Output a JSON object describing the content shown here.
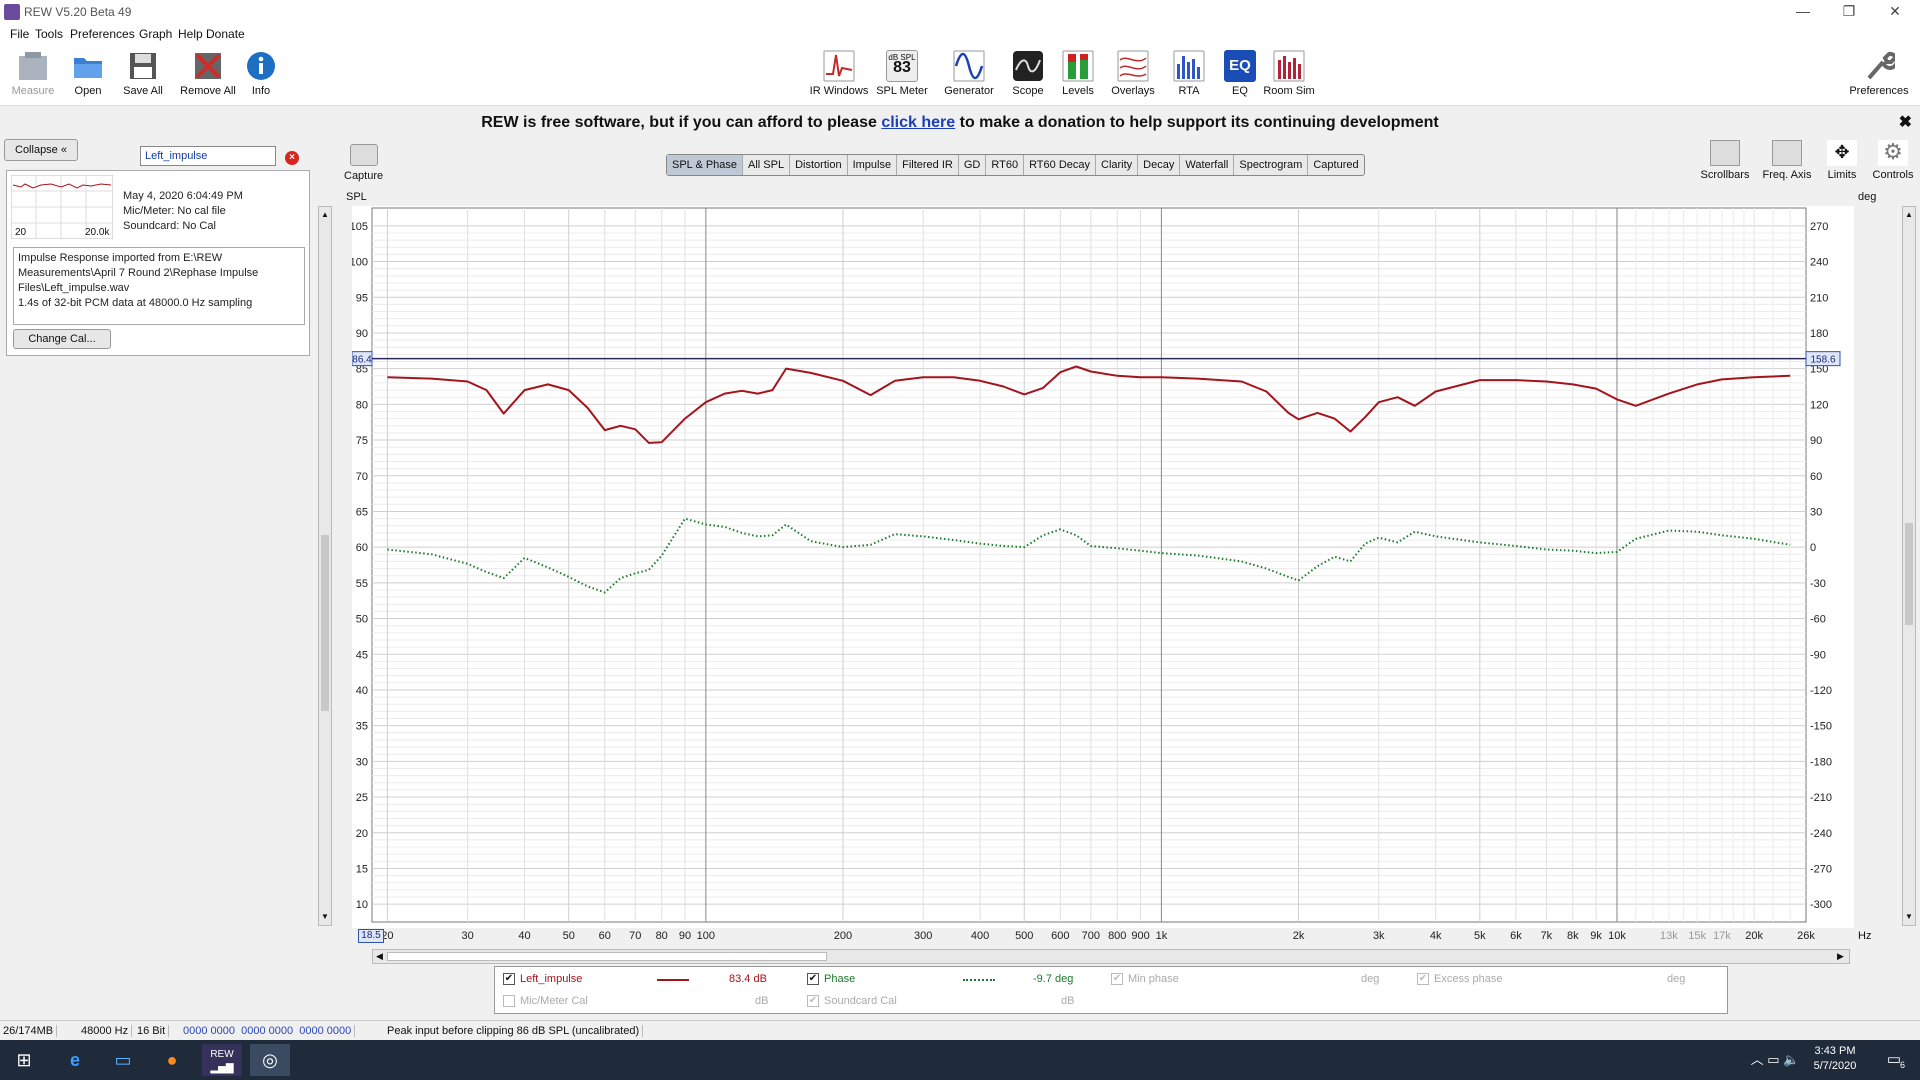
{
  "window": {
    "title": "REW V5.20 Beta 49",
    "min": "—",
    "max": "❐",
    "close": "✕"
  },
  "menu": [
    "File",
    "Tools",
    "Preferences",
    "Graph",
    "Help",
    "Donate"
  ],
  "toolbar_left": [
    {
      "label": "Measure",
      "icon": "microphone-icon",
      "color": "#9aa3ad"
    },
    {
      "label": "Open",
      "icon": "folder-icon",
      "color": "#3b7fd0"
    },
    {
      "label": "Save All",
      "icon": "floppy-icon",
      "color": "#555"
    },
    {
      "label": "Remove All",
      "icon": "remove-all-icon",
      "color": "#c0302a"
    },
    {
      "label": "Info",
      "icon": "info-icon",
      "color": "#1d6fc4"
    }
  ],
  "toolbar_center": [
    {
      "label": "IR Windows",
      "icon": "ir-windows-icon"
    },
    {
      "label": "SPL Meter",
      "icon": "spl-meter-icon",
      "value": "83",
      "unit": "dB SPL"
    },
    {
      "label": "Generator",
      "icon": "generator-icon"
    },
    {
      "label": "Scope",
      "icon": "scope-icon"
    },
    {
      "label": "Levels",
      "icon": "levels-icon"
    },
    {
      "label": "Overlays",
      "icon": "overlays-icon"
    },
    {
      "label": "RTA",
      "icon": "rta-icon"
    },
    {
      "label": "EQ",
      "icon": "eq-icon"
    },
    {
      "label": "Room Sim",
      "icon": "room-sim-icon"
    }
  ],
  "preferences_label": "Preferences",
  "donate": {
    "before": "REW is free software, but if you can afford to please",
    "link": "click here",
    "after": "to make a donation to help support its continuing development",
    "close": "✖"
  },
  "panel": {
    "collapse": "Collapse",
    "name": "Left_impulse",
    "date": "May 4, 2020 6:04:49 PM",
    "mic": "Mic/Meter: No cal file",
    "soundcard": "Soundcard: No Cal",
    "thumb_min": "20",
    "thumb_max": "20.0k",
    "notes": "Impulse Response imported from E:\\REW Measurements\\April 7 Round 2\\Rephase Impulse Files\\Left_impulse.wav\n1.4s of 32-bit PCM data at 48000.0 Hz sampling",
    "change_cal": "Change Cal..."
  },
  "capture": "Capture",
  "tabs": [
    "SPL & Phase",
    "All SPL",
    "Distortion",
    "Impulse",
    "Filtered IR",
    "GD",
    "RT60",
    "RT60 Decay",
    "Clarity",
    "Decay",
    "Waterfall",
    "Spectrogram",
    "Captured"
  ],
  "selected_tab": "SPL & Phase",
  "right_buttons": [
    "Scrollbars",
    "Freq. Axis",
    "Limits",
    "Controls"
  ],
  "axis": {
    "left_unit": "SPL",
    "right_unit": "deg",
    "x_unit": "Hz",
    "left_ticks": [
      "105",
      "100",
      "95",
      "90",
      "85",
      "80",
      "75",
      "70",
      "65",
      "60",
      "55",
      "50",
      "45",
      "40",
      "35",
      "30",
      "25",
      "20",
      "15",
      "10"
    ],
    "right_ticks": [
      "270",
      "240",
      "210",
      "180",
      "150",
      "120",
      "90",
      "60",
      "30",
      "0",
      "-30",
      "-60",
      "-90",
      "-120",
      "-150",
      "-180",
      "-210",
      "-240",
      "-270",
      "-300"
    ],
    "x_ticks": [
      "20",
      "30",
      "40",
      "50",
      "60",
      "70",
      "80",
      "90",
      "100",
      "200",
      "300",
      "400",
      "500",
      "600",
      "700",
      "800",
      "900",
      "1k",
      "2k",
      "3k",
      "4k",
      "5k",
      "6k",
      "7k",
      "8k",
      "9k",
      "10k",
      "13k",
      "15k",
      "17k",
      "20k",
      "26k"
    ],
    "cursor_left": "86.4",
    "cursor_right": "158.6",
    "cursor_x": "18.5"
  },
  "chart_data": {
    "type": "line",
    "xscale": "log",
    "xlim": [
      18.5,
      26000
    ],
    "ylim": [
      7.5,
      107.5
    ],
    "y2lim": [
      -315,
      285
    ],
    "series": [
      {
        "name": "Left_impulse",
        "axis": "SPL",
        "color": "#a4141d",
        "style": "solid",
        "x": [
          20,
          25,
          30,
          33,
          36,
          40,
          45,
          50,
          55,
          60,
          65,
          70,
          75,
          80,
          90,
          100,
          110,
          120,
          130,
          140,
          150,
          170,
          200,
          230,
          260,
          300,
          350,
          400,
          450,
          500,
          550,
          600,
          650,
          700,
          800,
          900,
          1000,
          1200,
          1500,
          1700,
          1900,
          2000,
          2200,
          2400,
          2600,
          2800,
          3000,
          3300,
          3600,
          4000,
          5000,
          6000,
          7000,
          8000,
          9000,
          10000,
          11000,
          13000,
          15000,
          17000,
          20000,
          24000
        ],
        "y": [
          83.8,
          83.6,
          83.2,
          82,
          78.7,
          82,
          82.8,
          82,
          79.5,
          76.4,
          77,
          76.5,
          74.6,
          74.7,
          78,
          80.3,
          81.5,
          81.9,
          81.5,
          82,
          85,
          84.4,
          83.3,
          81.3,
          83.3,
          83.8,
          83.8,
          83.3,
          82.5,
          81.4,
          82.3,
          84.5,
          85.3,
          84.6,
          84,
          83.8,
          83.8,
          83.6,
          83.2,
          81.8,
          78.8,
          77.9,
          78.8,
          78,
          76.2,
          78.2,
          80.3,
          81,
          79.8,
          81.8,
          83.4,
          83.4,
          83.2,
          82.8,
          82.2,
          80.7,
          79.8,
          81.5,
          82.8,
          83.5,
          83.8,
          84
        ]
      },
      {
        "name": "Phase",
        "axis": "deg",
        "color": "#1c7a2a",
        "style": "dotted",
        "x": [
          20,
          25,
          30,
          33,
          36,
          40,
          45,
          50,
          55,
          60,
          65,
          70,
          75,
          80,
          90,
          100,
          110,
          120,
          130,
          140,
          150,
          170,
          200,
          230,
          260,
          300,
          350,
          400,
          450,
          500,
          550,
          600,
          650,
          700,
          800,
          900,
          1000,
          1200,
          1500,
          1700,
          1900,
          2000,
          2200,
          2400,
          2600,
          2800,
          3000,
          3300,
          3600,
          4000,
          5000,
          6000,
          7000,
          8000,
          9000,
          10000,
          11000,
          13000,
          15000,
          17000,
          20000,
          24000
        ],
        "y": [
          -2,
          -6,
          -14,
          -21,
          -26,
          -9,
          -17,
          -25,
          -33,
          -38,
          -26,
          -22,
          -19,
          -7,
          24,
          19,
          17,
          12,
          9,
          10,
          19,
          5,
          0,
          2,
          11,
          9,
          6,
          3,
          1,
          0,
          10,
          15,
          10,
          1,
          -1,
          -3,
          -5,
          -7,
          -12,
          -18,
          -25,
          -28,
          -16,
          -8,
          -12,
          3,
          8,
          4,
          13,
          9,
          4,
          1,
          -2,
          -3,
          -5,
          -4,
          7,
          14,
          13,
          10,
          7,
          2
        ]
      }
    ]
  },
  "legend": [
    {
      "label": "Left_impulse",
      "value": "83.4 dB",
      "checked": true,
      "enabled": true,
      "style": "solid",
      "color": "#a4141d"
    },
    {
      "label": "Phase",
      "value": "-9.7 deg",
      "checked": true,
      "enabled": true,
      "style": "dotted",
      "color": "#1c7a2a"
    },
    {
      "label": "Min phase",
      "value": "deg",
      "checked": true,
      "enabled": false
    },
    {
      "label": "Excess phase",
      "value": "deg",
      "checked": true,
      "enabled": false
    },
    {
      "label": "Mic/Meter Cal",
      "value": "dB",
      "checked": false,
      "enabled": false
    },
    {
      "label": "Soundcard Cal",
      "value": "dB",
      "checked": true,
      "enabled": false
    }
  ],
  "status": [
    "26/174MB",
    "48000 Hz",
    "16 Bit",
    "0000 0000  0000 0000  0000 0000",
    "Peak input before clipping 86 dB SPL (uncalibrated)"
  ],
  "tray": {
    "time": "3:43 PM",
    "date": "5/7/2020",
    "badge": "6"
  }
}
